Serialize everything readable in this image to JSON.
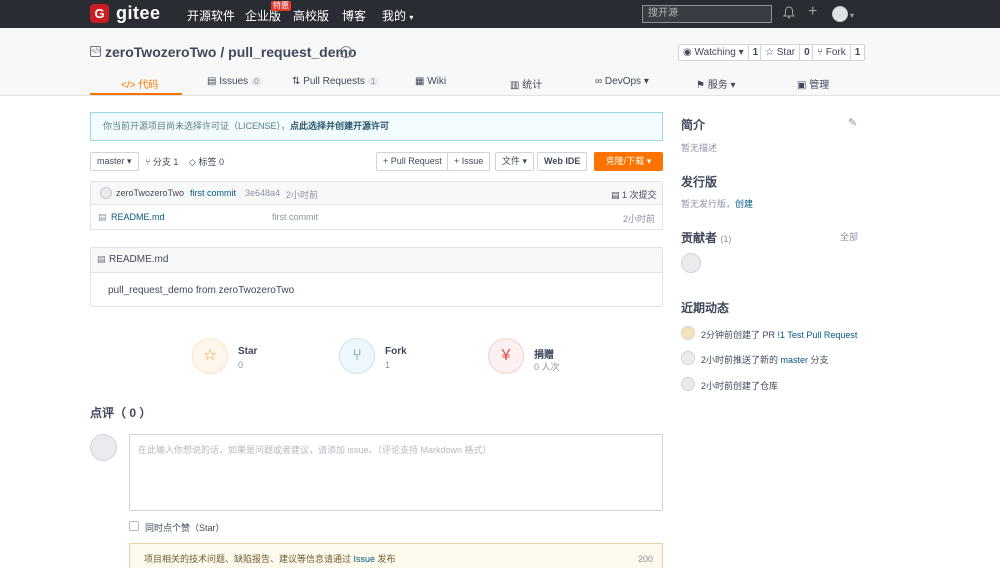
{
  "nav": {
    "logo_mark": "G",
    "logo": "gitee",
    "links": [
      "开源软件",
      "企业版",
      "高校版",
      "博客",
      "我的"
    ],
    "hot_badge": "特惠",
    "search_placeholder": "搜开源",
    "plus": "+"
  },
  "repo": {
    "owner": "zeroTwozeroTwo",
    "separator": " / ",
    "name": "pull_request_demo",
    "watch_label": "Watching",
    "watch_count": "1",
    "star_label": "Star",
    "star_count": "0",
    "fork_label": "Fork",
    "fork_count": "1"
  },
  "tabs": [
    {
      "label": "代码"
    },
    {
      "label": "Issues",
      "count": "0"
    },
    {
      "label": "Pull Requests",
      "count": "1"
    },
    {
      "label": "Wiki"
    },
    {
      "label": "统计"
    },
    {
      "label": "DevOps"
    },
    {
      "label": "服务"
    },
    {
      "label": "管理"
    }
  ],
  "notice": {
    "text": "你当前开源项目尚未选择许可证（LICENSE），",
    "link": "点此选择并创建开源许可"
  },
  "toolbar": {
    "branch": "master",
    "branches": "分支 1",
    "tags": "标签 0",
    "pull_request": "+ Pull Request",
    "issue": "+ Issue",
    "file": "文件",
    "web_ide": "Web IDE",
    "clone": "克隆/下载"
  },
  "commit": {
    "author": "zeroTwozeroTwo",
    "message": "first commit",
    "hash": "3e648a4",
    "time": "2小时前",
    "total": "1 次提交"
  },
  "files": [
    {
      "name": "README.md",
      "message": "first commit",
      "time": "2小时前"
    }
  ],
  "readme": {
    "filename": "README.md",
    "content": "pull_request_demo from zeroTwozeroTwo"
  },
  "stats": [
    {
      "label": "Star",
      "value": "0"
    },
    {
      "label": "Fork",
      "value": "1"
    },
    {
      "label": "捐赠",
      "value": "0 人次"
    }
  ],
  "comment": {
    "title": "点评（ 0 ）",
    "placeholder": "在此输入你想说的话，如果是问题或者建议，请添加 issue。（评论支持 Markdown 格式）",
    "star_checkbox": "同时点个赞（Star）",
    "warn_text": "项目相关的技术问题、缺陷报告、建议等信息请通过 ",
    "warn_link": "Issue",
    "warn_suffix": " 发布",
    "warn_count": "200"
  },
  "sidebar": {
    "intro_title": "简介",
    "intro_text": "暂无描述",
    "release_title": "发行版",
    "release_text": "暂无发行版，",
    "release_link": "创建",
    "contrib_title": "贡献者",
    "contrib_count": "(1)",
    "contrib_all": "全部",
    "activity_title": "近期动态",
    "activities": [
      {
        "prefix": "2分钟前创建了 PR ",
        "link": "!1 Test Pull Request",
        "suffix": ""
      },
      {
        "prefix": "2小时前推送了新的 ",
        "link": "master",
        "suffix": " 分支"
      },
      {
        "prefix": "2小时前创建了仓库",
        "link": "",
        "suffix": ""
      }
    ]
  }
}
